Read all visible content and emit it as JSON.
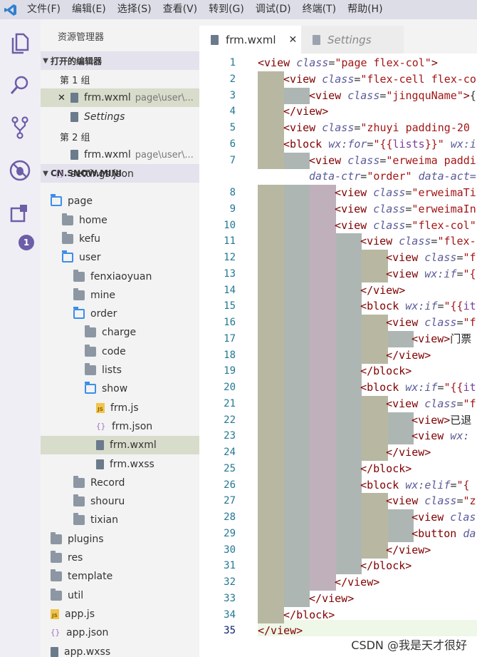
{
  "menu": [
    "文件(F)",
    "编辑(E)",
    "选择(S)",
    "查看(V)",
    "转到(G)",
    "调试(D)",
    "终端(T)",
    "帮助(H)"
  ],
  "activity": {
    "badge": "1",
    "icons": [
      "files-icon",
      "search-icon",
      "source-control-icon",
      "debug-icon",
      "extensions-icon"
    ]
  },
  "sidebar": {
    "title": "资源管理器",
    "open_editors": "打开的编辑器",
    "group1": "第 1 组",
    "group2": "第 2 组",
    "close_glyph": "✕",
    "oe_file1": "frm.wxml",
    "oe_file1_path": "page\\user\\...",
    "oe_file2": "Settings",
    "oe_file3": "frm.wxml",
    "oe_file3_path": "page\\user\\...",
    "project": "CN.SNOW.MINI",
    "tree": [
      {
        "label": "settings.json",
        "type": "json"
      },
      {
        "label": "page",
        "type": "open"
      },
      {
        "label": "home",
        "type": "closed"
      },
      {
        "label": "kefu",
        "type": "closed"
      },
      {
        "label": "user",
        "type": "open"
      },
      {
        "label": "fenxiaoyuan",
        "type": "closed"
      },
      {
        "label": "mine",
        "type": "closed"
      },
      {
        "label": "order",
        "type": "open"
      },
      {
        "label": "charge",
        "type": "closed"
      },
      {
        "label": "code",
        "type": "closed"
      },
      {
        "label": "lists",
        "type": "closed"
      },
      {
        "label": "show",
        "type": "open"
      },
      {
        "label": "frm.js",
        "type": "js"
      },
      {
        "label": "frm.json",
        "type": "json"
      },
      {
        "label": "frm.wxml",
        "type": "doc"
      },
      {
        "label": "frm.wxss",
        "type": "doc"
      },
      {
        "label": "Record",
        "type": "closed"
      },
      {
        "label": "shouru",
        "type": "closed"
      },
      {
        "label": "tixian",
        "type": "closed"
      },
      {
        "label": "plugins",
        "type": "closed"
      },
      {
        "label": "res",
        "type": "closed"
      },
      {
        "label": "template",
        "type": "closed"
      },
      {
        "label": "util",
        "type": "closed"
      },
      {
        "label": "app.js",
        "type": "js"
      },
      {
        "label": "app.json",
        "type": "json"
      },
      {
        "label": "app.wxss",
        "type": "doc"
      }
    ]
  },
  "tabs": [
    {
      "label": "frm.wxml",
      "close": "✕"
    },
    {
      "label": "Settings"
    }
  ],
  "editor": {
    "line_numbers": [
      "1",
      "2",
      "3",
      "4",
      "5",
      "6",
      "7",
      "",
      "8",
      "9",
      "10",
      "11",
      "12",
      "13",
      "14",
      "15",
      "16",
      "17",
      "18",
      "19",
      "20",
      "21",
      "22",
      "23",
      "24",
      "25",
      "26",
      "27",
      "28",
      "29",
      "30",
      "31",
      "32",
      "33",
      "34",
      "35"
    ],
    "active_line": "35",
    "lines": [
      [
        [
          "t",
          "<view "
        ],
        [
          "a",
          "class"
        ],
        [
          "p",
          "="
        ],
        [
          "s",
          "\"page flex-col\""
        ],
        [
          "t",
          ">"
        ]
      ],
      [
        [
          "t",
          "<view "
        ],
        [
          "a",
          "class"
        ],
        [
          "p",
          "="
        ],
        [
          "s",
          "\"flex-cell flex-co"
        ]
      ],
      [
        [
          "t",
          "<view "
        ],
        [
          "a",
          "class"
        ],
        [
          "p",
          "="
        ],
        [
          "s",
          "\"jingquName\""
        ],
        [
          "t",
          ">"
        ],
        [
          "p",
          "{"
        ]
      ],
      [
        [
          "t",
          "</view>"
        ]
      ],
      [
        [
          "t",
          "<view "
        ],
        [
          "a",
          "class"
        ],
        [
          "p",
          "="
        ],
        [
          "s",
          "\"zhuyi padding-20"
        ]
      ],
      [
        [
          "t",
          "<block "
        ],
        [
          "a",
          "wx:for"
        ],
        [
          "p",
          "="
        ],
        [
          "s",
          "\"{{"
        ],
        [
          "e",
          "lists"
        ],
        [
          "s",
          "}}\""
        ],
        [
          "p",
          " "
        ],
        [
          "a",
          "wx:i"
        ]
      ],
      [
        [
          "t",
          "<view "
        ],
        [
          "a",
          "class"
        ],
        [
          "p",
          "="
        ],
        [
          "s",
          "\"erweima paddi"
        ]
      ],
      [
        [
          "a",
          "data-ctr"
        ],
        [
          "p",
          "="
        ],
        [
          "s",
          "\"order\""
        ],
        [
          "p",
          " "
        ],
        [
          "a",
          "data-act="
        ]
      ],
      [
        [
          "t",
          "<view "
        ],
        [
          "a",
          "class"
        ],
        [
          "p",
          "="
        ],
        [
          "s",
          "\"erweimaTi"
        ]
      ],
      [
        [
          "t",
          "<view "
        ],
        [
          "a",
          "class"
        ],
        [
          "p",
          "="
        ],
        [
          "s",
          "\"erweimaIn"
        ]
      ],
      [
        [
          "t",
          "<view "
        ],
        [
          "a",
          "class"
        ],
        [
          "p",
          "="
        ],
        [
          "s",
          "\"flex-col\""
        ]
      ],
      [
        [
          "t",
          "<view "
        ],
        [
          "a",
          "class"
        ],
        [
          "p",
          "="
        ],
        [
          "s",
          "\"flex-"
        ]
      ],
      [
        [
          "t",
          "<view "
        ],
        [
          "a",
          "class"
        ],
        [
          "p",
          "="
        ],
        [
          "s",
          "\"f"
        ]
      ],
      [
        [
          "t",
          "<view "
        ],
        [
          "a",
          "wx:if"
        ],
        [
          "p",
          "="
        ],
        [
          "s",
          "\"{"
        ]
      ],
      [
        [
          "t",
          "</view>"
        ]
      ],
      [
        [
          "t",
          "<block "
        ],
        [
          "a",
          "wx:if"
        ],
        [
          "p",
          "="
        ],
        [
          "s",
          "\"{{"
        ],
        [
          "e",
          "it"
        ]
      ],
      [
        [
          "t",
          "<view "
        ],
        [
          "a",
          "class"
        ],
        [
          "p",
          "="
        ],
        [
          "s",
          "\"f"
        ]
      ],
      [
        [
          "t",
          "<view>"
        ],
        [
          "x",
          "门票"
        ]
      ],
      [
        [
          "t",
          "</view>"
        ]
      ],
      [
        [
          "t",
          "</block>"
        ]
      ],
      [
        [
          "t",
          "<block "
        ],
        [
          "a",
          "wx:if"
        ],
        [
          "p",
          "="
        ],
        [
          "s",
          "\"{{"
        ],
        [
          "e",
          "it"
        ]
      ],
      [
        [
          "t",
          "<view "
        ],
        [
          "a",
          "class"
        ],
        [
          "p",
          "="
        ],
        [
          "s",
          "\"f"
        ]
      ],
      [
        [
          "t",
          "<view>"
        ],
        [
          "x",
          "已退"
        ]
      ],
      [
        [
          "t",
          "<view "
        ],
        [
          "a",
          "wx:"
        ]
      ],
      [
        [
          "t",
          "</view>"
        ]
      ],
      [
        [
          "t",
          "</block>"
        ]
      ],
      [
        [
          "t",
          "<block "
        ],
        [
          "a",
          "wx:elif"
        ],
        [
          "p",
          "="
        ],
        [
          "s",
          "\"{"
        ]
      ],
      [
        [
          "t",
          "<view "
        ],
        [
          "a",
          "class"
        ],
        [
          "p",
          "="
        ],
        [
          "s",
          "\"z"
        ]
      ],
      [
        [
          "t",
          "<view "
        ],
        [
          "a",
          "clas"
        ]
      ],
      [
        [
          "t",
          "<button "
        ],
        [
          "a",
          "da"
        ]
      ],
      [
        [
          "t",
          "</view>"
        ]
      ],
      [
        [
          "t",
          "</block>"
        ]
      ],
      [
        [
          "t",
          "</view>"
        ]
      ],
      [
        [
          "t",
          "</view>"
        ]
      ],
      [
        [
          "t",
          "</block>"
        ]
      ],
      [
        [
          "t",
          "</view>"
        ]
      ]
    ]
  },
  "watermark": "CSDN @我是天才很好",
  "colors": {
    "guide1": "#b8b8a2",
    "guide2": "#aeb6b3",
    "guide3": "#bfb0bc",
    "accent": "#6c5ea8"
  }
}
